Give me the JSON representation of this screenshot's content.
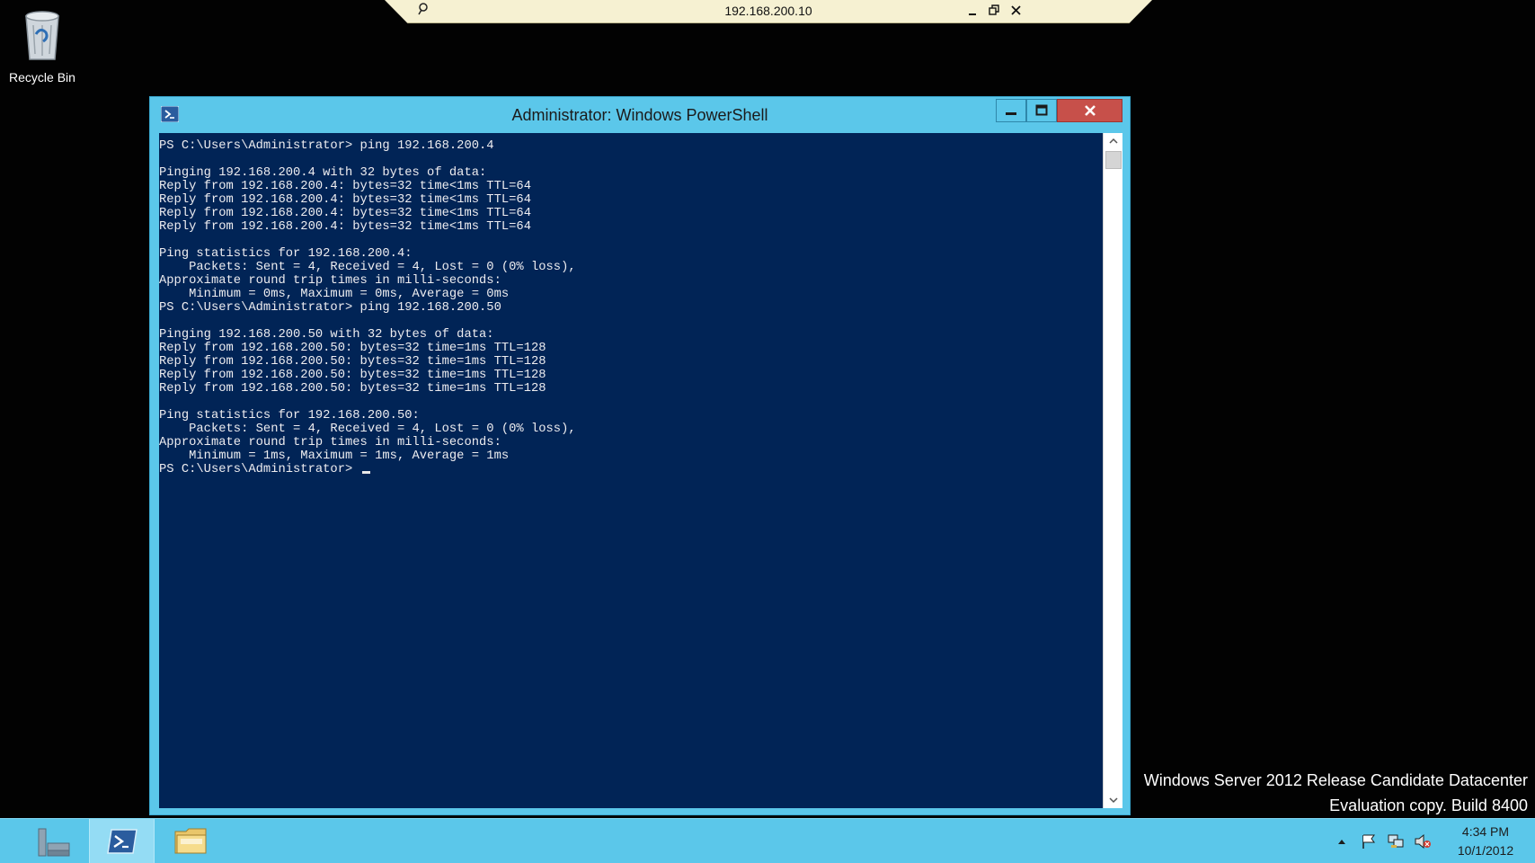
{
  "desktop": {
    "recycle_bin_label": "Recycle Bin"
  },
  "rdp_bar": {
    "title": "192.168.200.10"
  },
  "window": {
    "title": "Administrator: Windows PowerShell",
    "console_lines": [
      "PS C:\\Users\\Administrator> ping 192.168.200.4",
      "",
      "Pinging 192.168.200.4 with 32 bytes of data:",
      "Reply from 192.168.200.4: bytes=32 time<1ms TTL=64",
      "Reply from 192.168.200.4: bytes=32 time<1ms TTL=64",
      "Reply from 192.168.200.4: bytes=32 time<1ms TTL=64",
      "Reply from 192.168.200.4: bytes=32 time<1ms TTL=64",
      "",
      "Ping statistics for 192.168.200.4:",
      "    Packets: Sent = 4, Received = 4, Lost = 0 (0% loss),",
      "Approximate round trip times in milli-seconds:",
      "    Minimum = 0ms, Maximum = 0ms, Average = 0ms",
      "PS C:\\Users\\Administrator> ping 192.168.200.50",
      "",
      "Pinging 192.168.200.50 with 32 bytes of data:",
      "Reply from 192.168.200.50: bytes=32 time=1ms TTL=128",
      "Reply from 192.168.200.50: bytes=32 time=1ms TTL=128",
      "Reply from 192.168.200.50: bytes=32 time=1ms TTL=128",
      "Reply from 192.168.200.50: bytes=32 time=1ms TTL=128",
      "",
      "Ping statistics for 192.168.200.50:",
      "    Packets: Sent = 4, Received = 4, Lost = 0 (0% loss),",
      "Approximate round trip times in milli-seconds:",
      "    Minimum = 1ms, Maximum = 1ms, Average = 1ms"
    ],
    "prompt": "PS C:\\Users\\Administrator> "
  },
  "watermark": {
    "line1": "Windows Server 2012 Release Candidate Datacenter",
    "line2": "Evaluation copy. Build 8400"
  },
  "taskbar": {
    "time": "4:34 PM",
    "date": "10/1/2012"
  },
  "colors": {
    "console_bg": "#012456",
    "accent": "#5bc7ea",
    "close_button": "#c7504a"
  },
  "icons": {
    "recycle_bin": "recycle-bin-icon",
    "pin": "pin-icon",
    "powershell": "powershell-icon",
    "server_manager": "server-manager-icon",
    "file_explorer": "file-explorer-icon",
    "flag": "flag-icon",
    "network": "network-icon",
    "volume": "volume-muted-icon"
  }
}
